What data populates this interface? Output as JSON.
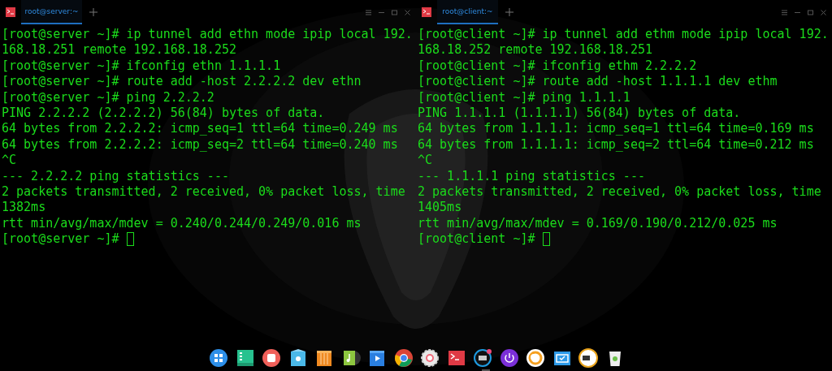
{
  "panes": [
    {
      "tab": {
        "title": "root@server:~",
        "selected": true
      },
      "lines": [
        "[root@server ~]# ip tunnel add ethn mode ipip local 192.",
        "168.18.251 remote 192.168.18.252",
        "[root@server ~]# ifconfig ethn 1.1.1.1",
        "[root@server ~]# route add -host 2.2.2.2 dev ethn",
        "[root@server ~]# ping 2.2.2.2",
        "PING 2.2.2.2 (2.2.2.2) 56(84) bytes of data.",
        "64 bytes from 2.2.2.2: icmp_seq=1 ttl=64 time=0.249 ms",
        "64 bytes from 2.2.2.2: icmp_seq=2 ttl=64 time=0.240 ms",
        "^C",
        "--- 2.2.2.2 ping statistics ---",
        "2 packets transmitted, 2 received, 0% packet loss, time",
        "1382ms",
        "rtt min/avg/max/mdev = 0.240/0.244/0.249/0.016 ms"
      ],
      "prompt": "[root@server ~]#"
    },
    {
      "tab": {
        "title": "root@client:~",
        "selected": true
      },
      "lines": [
        "[root@client ~]# ip tunnel add ethm mode ipip local 192.",
        "168.18.252 remote 192.168.18.251",
        "[root@client ~]# ifconfig ethm 2.2.2.2",
        "[root@client ~]# route add -host 1.1.1.1 dev ethm",
        "[root@client ~]# ping 1.1.1.1",
        "PING 1.1.1.1 (1.1.1.1) 56(84) bytes of data.",
        "64 bytes from 1.1.1.1: icmp_seq=1 ttl=64 time=0.169 ms",
        "64 bytes from 1.1.1.1: icmp_seq=2 ttl=64 time=0.212 ms",
        "^C",
        "--- 1.1.1.1 ping statistics ---",
        "2 packets transmitted, 2 received, 0% packet loss, time",
        "1405ms",
        "rtt min/avg/max/mdev = 0.169/0.190/0.212/0.025 ms"
      ],
      "prompt": "[root@client ~]#"
    }
  ]
}
